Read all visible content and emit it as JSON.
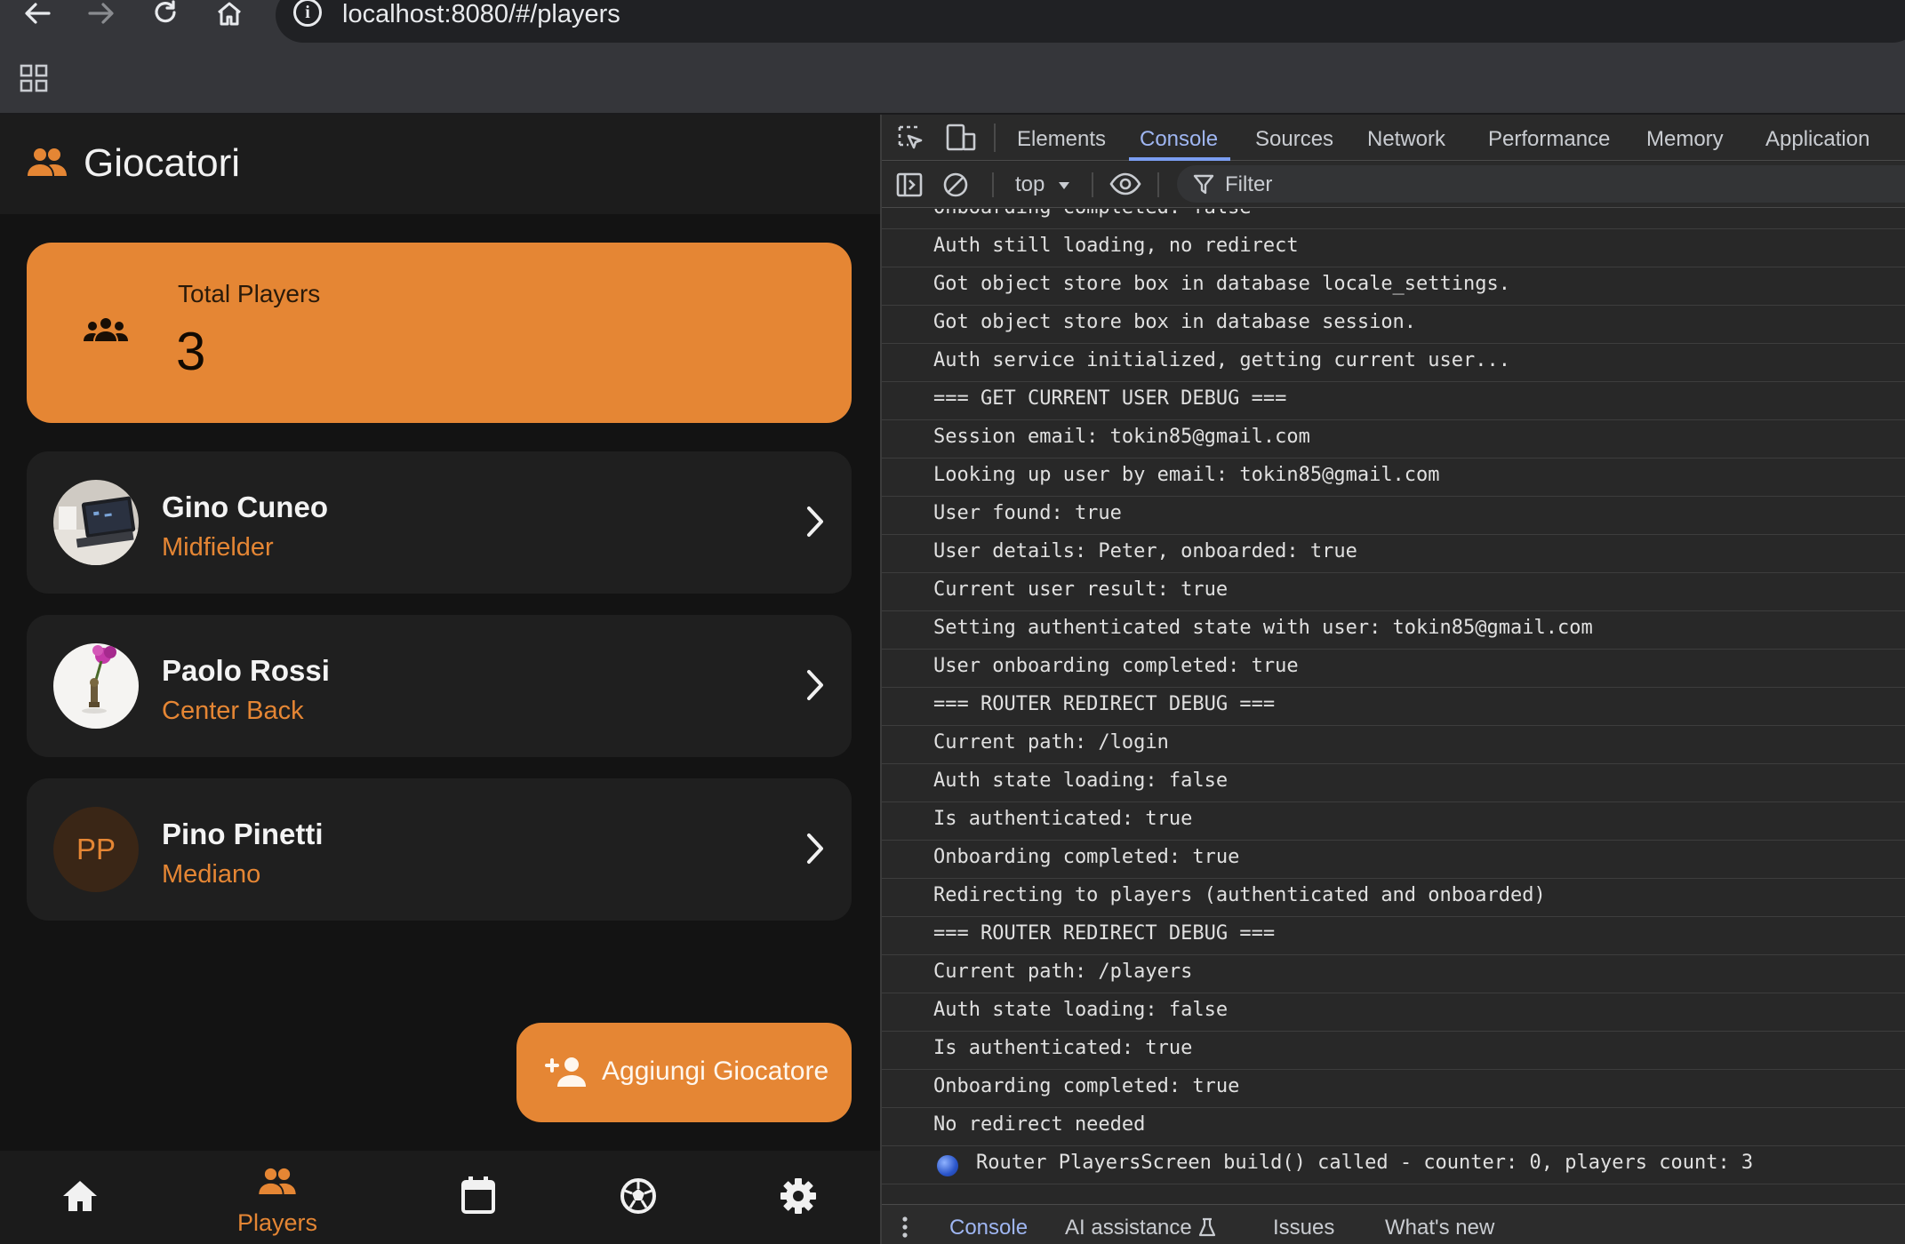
{
  "browser": {
    "url": "localhost:8080/#/players"
  },
  "app": {
    "title": "Giocatori",
    "stats": {
      "label": "Total Players",
      "value": "3"
    },
    "players": [
      {
        "name": "Gino Cuneo",
        "role": "Midfielder",
        "avatar": "photo-laptop"
      },
      {
        "name": "Paolo Rossi",
        "role": "Center Back",
        "avatar": "photo-flower"
      },
      {
        "name": "Pino Pinetti",
        "role": "Mediano",
        "avatar": "initials",
        "initials": "PP"
      }
    ],
    "fab_label": "Aggiungi Giocatore",
    "nav": {
      "players_label": "Players"
    },
    "colors": {
      "accent": "#e58634",
      "background": "#131313",
      "card": "#1f1f1f"
    }
  },
  "devtools": {
    "tabs": [
      "Elements",
      "Console",
      "Sources",
      "Network",
      "Performance",
      "Memory",
      "Application"
    ],
    "active_tab": "Console",
    "context": "top",
    "filter_placeholder": "Filter",
    "log": [
      "Onboarding completed: false",
      "Auth still loading, no redirect",
      "Got object store box in database locale_settings.",
      "Got object store box in database session.",
      "Auth service initialized, getting current user...",
      "=== GET CURRENT USER DEBUG ===",
      "Session email: tokin85@gmail.com",
      "Looking up user by email: tokin85@gmail.com",
      "User found: true",
      "User details: Peter, onboarded: true",
      "Current user result: true",
      "Setting authenticated state with user: tokin85@gmail.com",
      "User onboarding completed: true",
      "=== ROUTER REDIRECT DEBUG ===",
      "Current path: /login",
      "Auth state loading: false",
      "Is authenticated: true",
      "Onboarding completed: true",
      "Redirecting to players (authenticated and onboarded)",
      "=== ROUTER REDIRECT DEBUG ===",
      "Current path: /players",
      "Auth state loading: false",
      "Is authenticated: true",
      "Onboarding completed: true",
      "No redirect needed",
      "Router PlayersScreen build() called - counter: 0, players count: 3"
    ],
    "drawer_tabs": [
      "Console",
      "AI assistance",
      "Issues",
      "What's new"
    ],
    "active_drawer_tab": "Console"
  }
}
